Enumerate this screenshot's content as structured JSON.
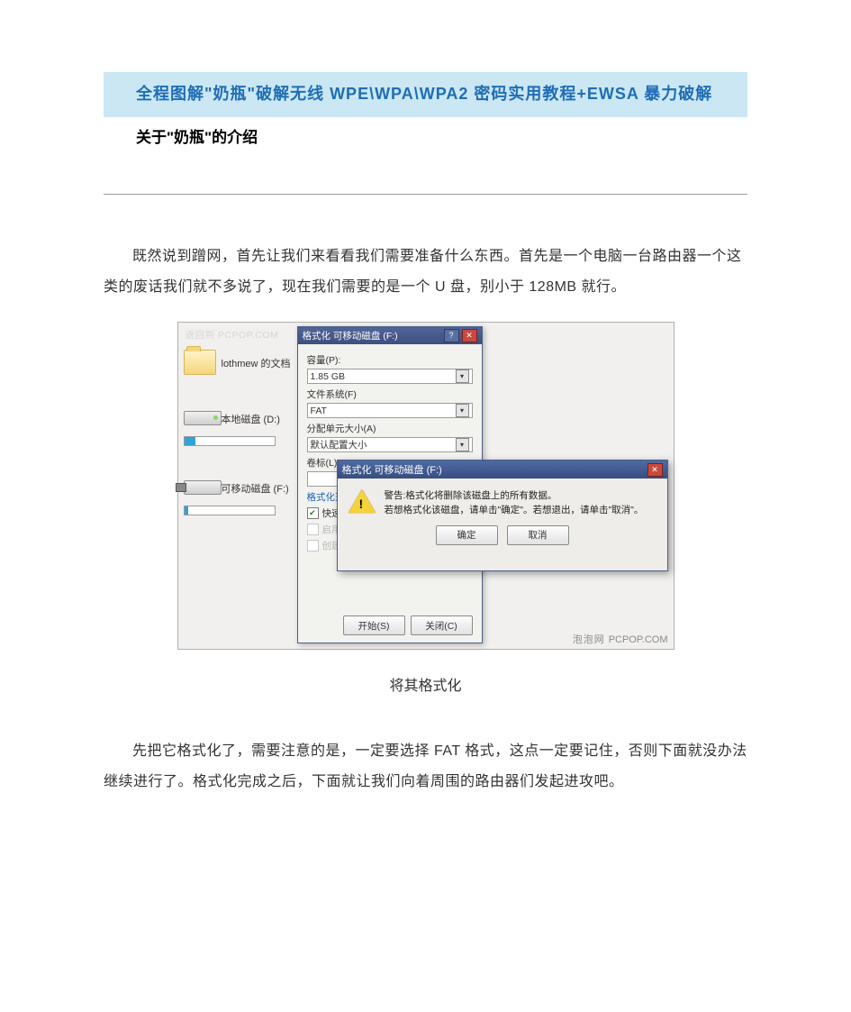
{
  "doc": {
    "banner_title": "全程图解\"奶瓶\"破解无线 WPE\\WPA\\WPA2  密码实用教程+EWSA 暴力破解",
    "subtitle": "关于\"奶瓶\"的介绍",
    "para1": "既然说到蹭网，首先让我们来看看我们需要准备什么东西。首先是一个电脑一台路由器一个这类的废话我们就不多说了，现在我们需要的是一个 U 盘，别小于 128MB 就行。",
    "caption": "将其格式化",
    "para2": "先把它格式化了，需要注意的是，一定要选择 FAT 格式，这点一定要记住，否则下面就没办法继续进行了。格式化完成之后，下面就让我们向着周围的路由器们发起进攻吧。"
  },
  "explorer": {
    "top_text": "返回到 PCPOP.COM",
    "drives": {
      "docs": "lothmew 的文档",
      "hdd": "本地磁盘 (D:)",
      "usb": "可移动磁盘 (F:)"
    }
  },
  "format": {
    "title": "格式化 可移动磁盘 (F:)",
    "capacity_label": "容量(P):",
    "capacity_value": "1.85 GB",
    "fs_label": "文件系统(F)",
    "fs_value": "FAT",
    "alloc_label": "分配单元大小(A)",
    "alloc_value": "默认配置大小",
    "vol_label": "卷标(L)",
    "vol_value": "",
    "opts_title": "格式化选项(O)",
    "quick": "快速格式化(Q)",
    "compress": "启用压缩(E)",
    "msboot": "创建一个 MS-DOS 启动盘(M)",
    "start": "开始(S)",
    "close": "关闭(C)"
  },
  "warn": {
    "title": "格式化 可移动磁盘 (F:)",
    "line1": "警告:格式化将删除该磁盘上的所有数据。",
    "line2": "若想格式化该磁盘，请单击\"确定\"。若想退出，请单击\"取消\"。",
    "ok": "确定",
    "cancel": "取消"
  },
  "watermark": {
    "cn": "泡泡网",
    "en": "PCPOP.COM"
  }
}
